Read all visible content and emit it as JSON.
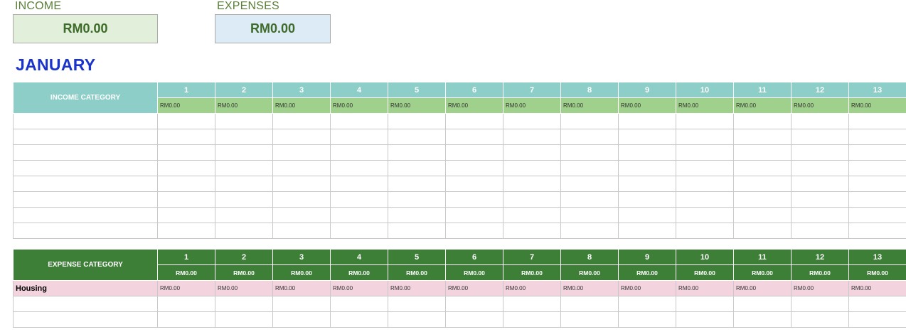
{
  "summary": {
    "income_label": "INCOME",
    "income_value": "RM0.00",
    "expenses_label": "EXPENSES",
    "expenses_value": "RM0.00"
  },
  "month": "JANUARY",
  "income_table": {
    "category_header": "INCOME CATEGORY",
    "days": [
      "1",
      "2",
      "3",
      "4",
      "5",
      "6",
      "7",
      "8",
      "9",
      "10",
      "11",
      "12",
      "13"
    ],
    "day_totals": [
      "RM0.00",
      "RM0.00",
      "RM0.00",
      "RM0.00",
      "RM0.00",
      "RM0.00",
      "RM0.00",
      "RM0.00",
      "RM0.00",
      "RM0.00",
      "RM0.00",
      "RM0.00",
      "RM0.00"
    ]
  },
  "expense_table": {
    "category_header": "EXPENSE CATEGORY",
    "days": [
      "1",
      "2",
      "3",
      "4",
      "5",
      "6",
      "7",
      "8",
      "9",
      "10",
      "11",
      "12",
      "13"
    ],
    "day_totals": [
      "RM0.00",
      "RM0.00",
      "RM0.00",
      "RM0.00",
      "RM0.00",
      "RM0.00",
      "RM0.00",
      "RM0.00",
      "RM0.00",
      "RM0.00",
      "RM0.00",
      "RM0.00",
      "RM0.00"
    ],
    "rows": [
      {
        "label": "Housing",
        "values": [
          "RM0.00",
          "RM0.00",
          "RM0.00",
          "RM0.00",
          "RM0.00",
          "RM0.00",
          "RM0.00",
          "RM0.00",
          "RM0.00",
          "RM0.00",
          "RM0.00",
          "RM0.00",
          "RM0.00"
        ]
      }
    ]
  },
  "colors": {
    "income_header": "#8dcfc8",
    "income_totals": "#a0d18c",
    "expense_header": "#3e7f38",
    "housing_row": "#f2d3de",
    "month_title": "#1a33cc"
  }
}
